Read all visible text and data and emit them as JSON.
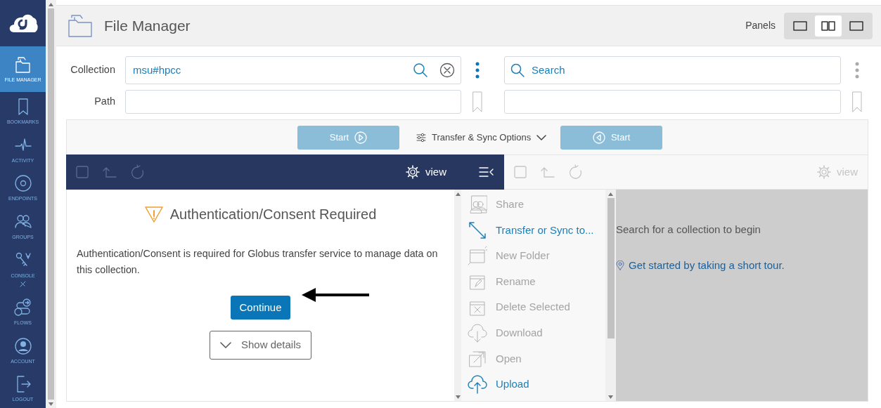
{
  "sidebar": {
    "items": [
      {
        "label": "FILE MANAGER",
        "kind": "files",
        "selected": true
      },
      {
        "label": "BOOKMARKS",
        "kind": "bookmark",
        "selected": false
      },
      {
        "label": "ACTIVITY",
        "kind": "pulse",
        "selected": false
      },
      {
        "label": "ENDPOINTS",
        "kind": "disc",
        "selected": false
      },
      {
        "label": "GROUPS",
        "kind": "people",
        "selected": false
      },
      {
        "label": "CONSOLE",
        "kind": "key",
        "selected": false
      },
      {
        "label": "FLOWS",
        "kind": "flow",
        "selected": false
      },
      {
        "label": "ACCOUNT",
        "kind": "person",
        "selected": false
      },
      {
        "label": "LOGOUT",
        "kind": "door",
        "selected": false
      }
    ]
  },
  "header": {
    "title": "File Manager",
    "panels_label": "Panels",
    "panel_layouts": [
      {
        "kind": "single",
        "selected": false
      },
      {
        "kind": "split",
        "selected": true
      },
      {
        "kind": "single",
        "selected": false
      }
    ]
  },
  "collection_bar": {
    "collection_label": "Collection",
    "collection_value": "msu#hpcc",
    "path_label": "Path",
    "search_placeholder": "Search"
  },
  "transfer_bar": {
    "start_left": "Start",
    "options": "Transfer & Sync Options",
    "start_right": "Start"
  },
  "panels": [
    {
      "active": true,
      "view_label": "view"
    },
    {
      "active": false,
      "view_label": "view"
    }
  ],
  "auth": {
    "title": "Authentication/Consent Required",
    "message": "Authentication/Consent is required for Globus transfer service to manage data on this collection.",
    "continue": "Continue",
    "details": "Show details"
  },
  "actions": [
    {
      "label": "Share",
      "kind": "share",
      "disabled": true
    },
    {
      "label": "Transfer or Sync to...",
      "kind": "transfer",
      "disabled": false
    },
    {
      "label": "New Folder",
      "kind": "new-folder",
      "disabled": true
    },
    {
      "label": "Rename",
      "kind": "rename",
      "disabled": true
    },
    {
      "label": "Delete Selected",
      "kind": "delete",
      "disabled": true
    },
    {
      "label": "Download",
      "kind": "download",
      "disabled": true
    },
    {
      "label": "Open",
      "kind": "open",
      "disabled": true
    },
    {
      "label": "Upload",
      "kind": "upload",
      "disabled": false
    }
  ],
  "right_panel": {
    "message": "Search for a collection to begin",
    "tour_link": "Get started by taking a short tour."
  }
}
